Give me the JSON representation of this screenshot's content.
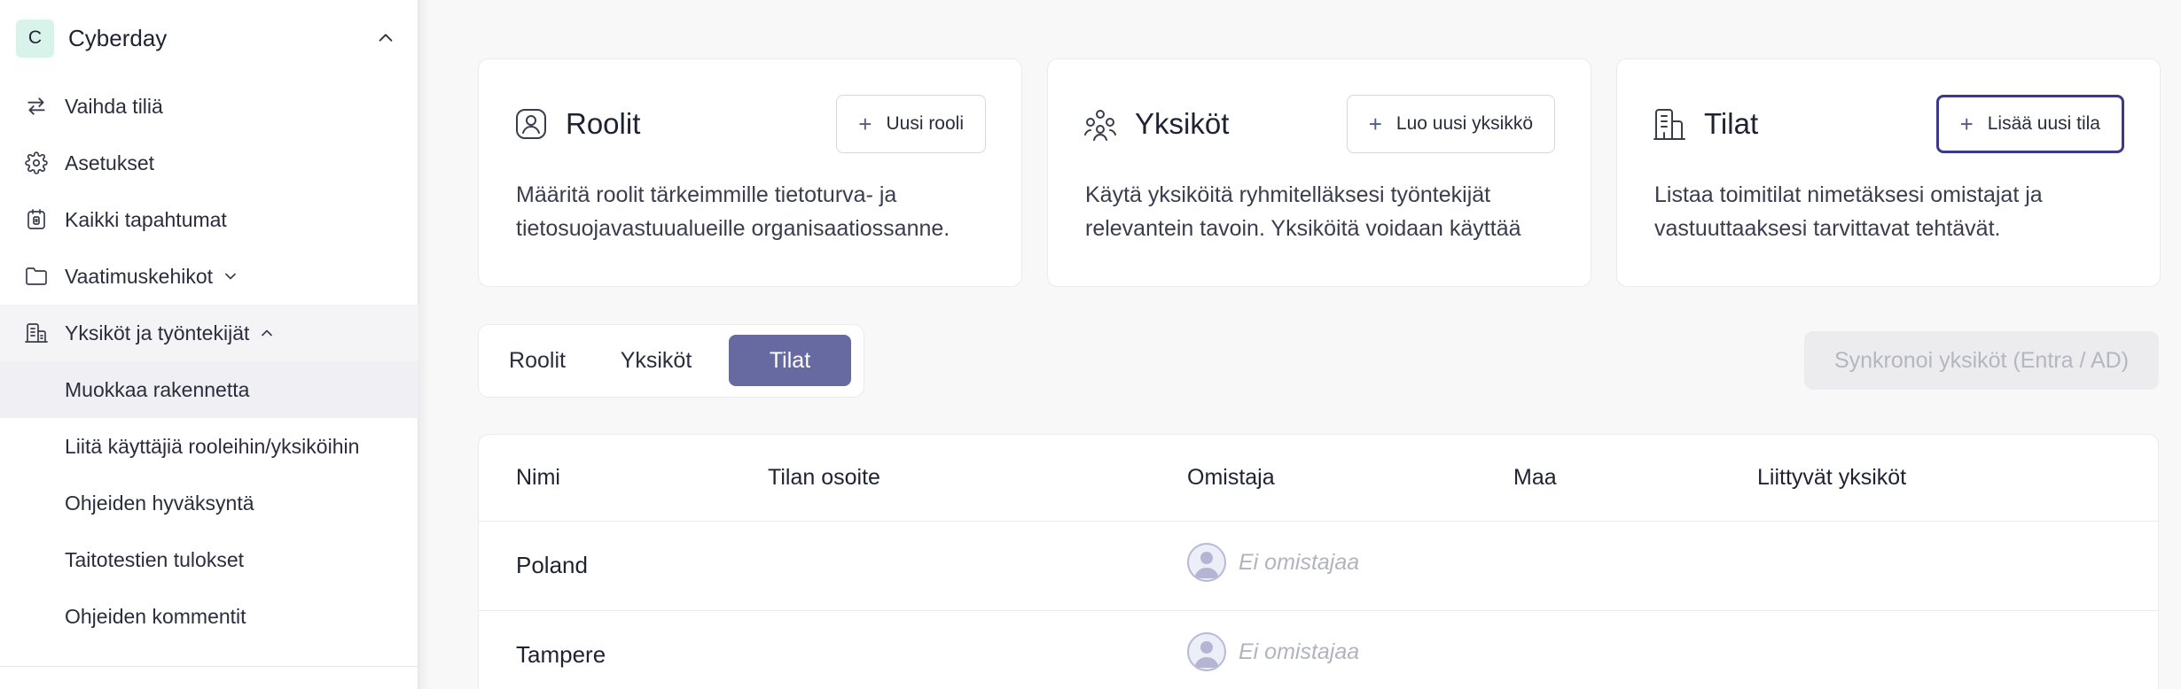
{
  "sidebar": {
    "org": {
      "initial": "C",
      "name": "Cyberday"
    },
    "items": [
      {
        "label": "Vaihda tiliä",
        "icon": "swap-icon"
      },
      {
        "label": "Asetukset",
        "icon": "gear-icon"
      },
      {
        "label": "Kaikki tapahtumat",
        "icon": "calendar-icon"
      },
      {
        "label": "Vaatimuskehikot",
        "icon": "folder-icon"
      },
      {
        "label": "Yksiköt ja työntekijät",
        "icon": "building-icon"
      }
    ],
    "subitems": [
      {
        "label": "Muokkaa rakennetta"
      },
      {
        "label": "Liitä käyttäjiä rooleihin/yksiköihin"
      },
      {
        "label": "Ohjeiden hyväksyntä"
      },
      {
        "label": "Taitotestien tulokset"
      },
      {
        "label": "Ohjeiden kommentit"
      }
    ]
  },
  "cards": [
    {
      "title": "Roolit",
      "button": "Uusi rooli",
      "text": "Määritä roolit tärkeimmille tietoturva- ja tietosuojavastuualueille organisaatiossanne."
    },
    {
      "title": "Yksiköt",
      "button": "Luo uusi yksikkö",
      "text": "Käytä yksiköitä ryhmitelläksesi työntekijät relevantein tavoin. Yksiköitä voidaan käyttää"
    },
    {
      "title": "Tilat",
      "button": "Lisää uusi tila",
      "text": "Listaa toimitilat nimetäksesi omistajat ja vastuuttaaksesi tarvittavat tehtävät."
    }
  ],
  "tabs": [
    {
      "label": "Roolit"
    },
    {
      "label": "Yksiköt"
    },
    {
      "label": "Tilat",
      "selected": true
    }
  ],
  "sync_button": "Synkronoi yksiköt (Entra / AD)",
  "table": {
    "columns": [
      "Nimi",
      "Tilan osoite",
      "Omistaja",
      "Maa",
      "Liittyvät yksiköt"
    ],
    "rows": [
      {
        "name": "Poland",
        "address": "",
        "owner": "Ei omistajaa",
        "country": "",
        "units": ""
      },
      {
        "name": "Tampere",
        "address": "",
        "owner": "Ei omistajaa",
        "country": "",
        "units": ""
      }
    ]
  },
  "colors": {
    "accent": "#676aa1",
    "focus_border": "#3b3a8a",
    "org_avatar_bg": "#d7f3ea"
  }
}
